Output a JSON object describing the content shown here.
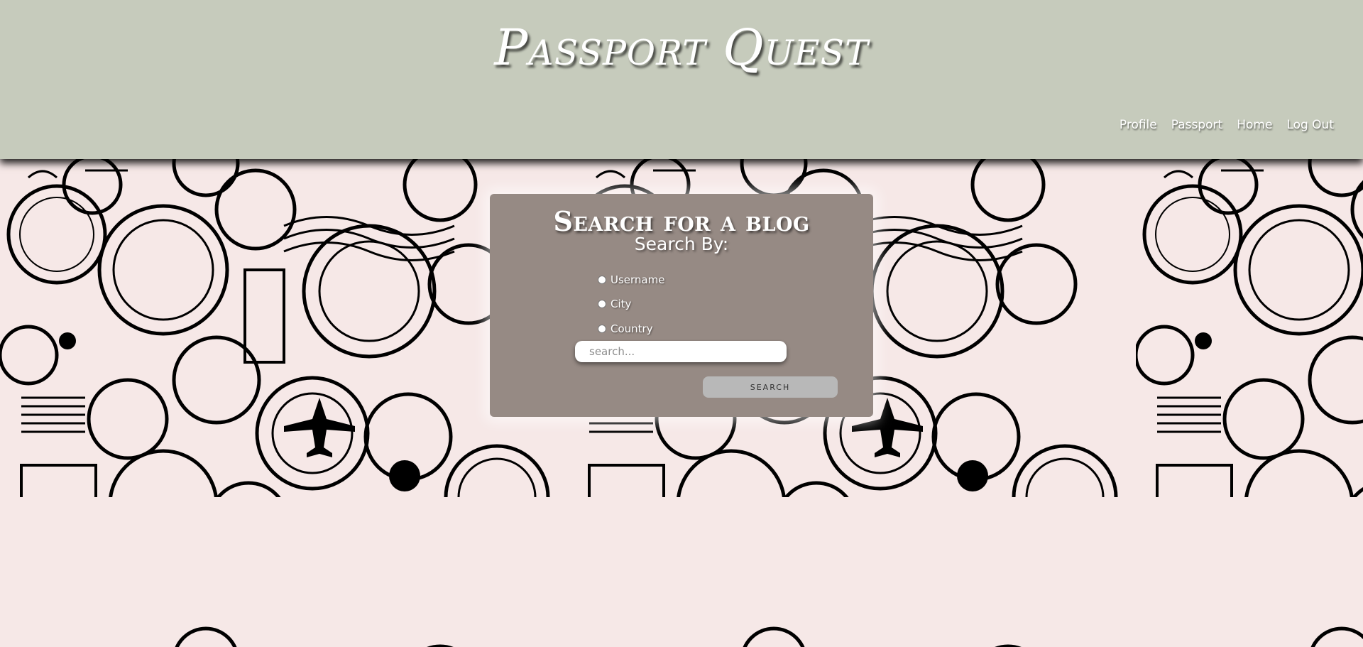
{
  "header": {
    "title": "Passport Quest",
    "background_color": "#c6cbbc"
  },
  "nav": {
    "items": [
      {
        "label": "Profile"
      },
      {
        "label": "Passport"
      },
      {
        "label": "Home"
      },
      {
        "label": "Log Out"
      }
    ]
  },
  "search_card": {
    "title": "Search for a blog",
    "subtitle": "Search By:",
    "background_color": "#968a84",
    "options": [
      {
        "label": "Username",
        "value": "username"
      },
      {
        "label": "City",
        "value": "city"
      },
      {
        "label": "Country",
        "value": "country"
      }
    ],
    "input_placeholder": "search...",
    "input_value": "",
    "button_label": "Search"
  },
  "background": {
    "color": "#f6e8e7",
    "pattern": "postage-stamp-icon"
  }
}
